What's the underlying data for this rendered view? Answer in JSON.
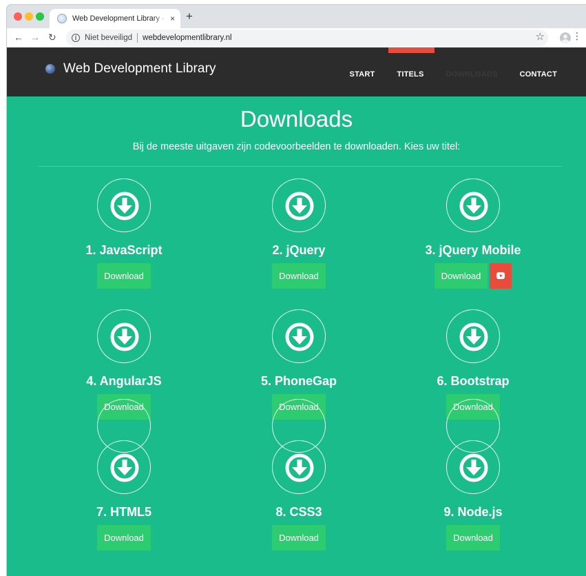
{
  "browser": {
    "tab_title": "Web Development Library - Kwik",
    "tab_close": "×",
    "new_tab": "+",
    "security_label": "Niet beveiligd",
    "url": "webdevelopmentlibrary.nl",
    "icons": {
      "back": "arrow-left-icon",
      "forward": "arrow-right-icon",
      "reload": "reload-icon",
      "info": "info-icon",
      "star": "star-icon",
      "account": "account-icon",
      "menu": "kebab-menu-icon"
    }
  },
  "site": {
    "brand": "Web Development Library",
    "nav": [
      {
        "label": "START"
      },
      {
        "label": "TITELS"
      },
      {
        "label": "DOWNLOADS"
      },
      {
        "label": "CONTACT"
      }
    ],
    "title": "Downloads",
    "subtitle": "Bij de meeste uitgaven zijn codevoorbeelden te downloaden. Kies uw titel:",
    "colors": {
      "background": "#1abc8c",
      "navbar": "#2c2c2c",
      "accent": "#e74c3c",
      "button": "#2ecc71"
    }
  },
  "downloads": [
    {
      "title": "1. JavaScript",
      "button": "Download"
    },
    {
      "title": "2. jQuery",
      "button": "Download"
    },
    {
      "title": "3. jQuery Mobile",
      "button": "Download",
      "video": true
    },
    {
      "title": "4. AngularJS",
      "button": "Download"
    },
    {
      "title": "5. PhoneGap",
      "button": "Download"
    },
    {
      "title": "6. Bootstrap",
      "button": "Download"
    },
    {
      "title": "7. HTML5",
      "button": "Download"
    },
    {
      "title": "8. CSS3",
      "button": "Download"
    },
    {
      "title": "9. Node.js",
      "button": "Download"
    }
  ]
}
